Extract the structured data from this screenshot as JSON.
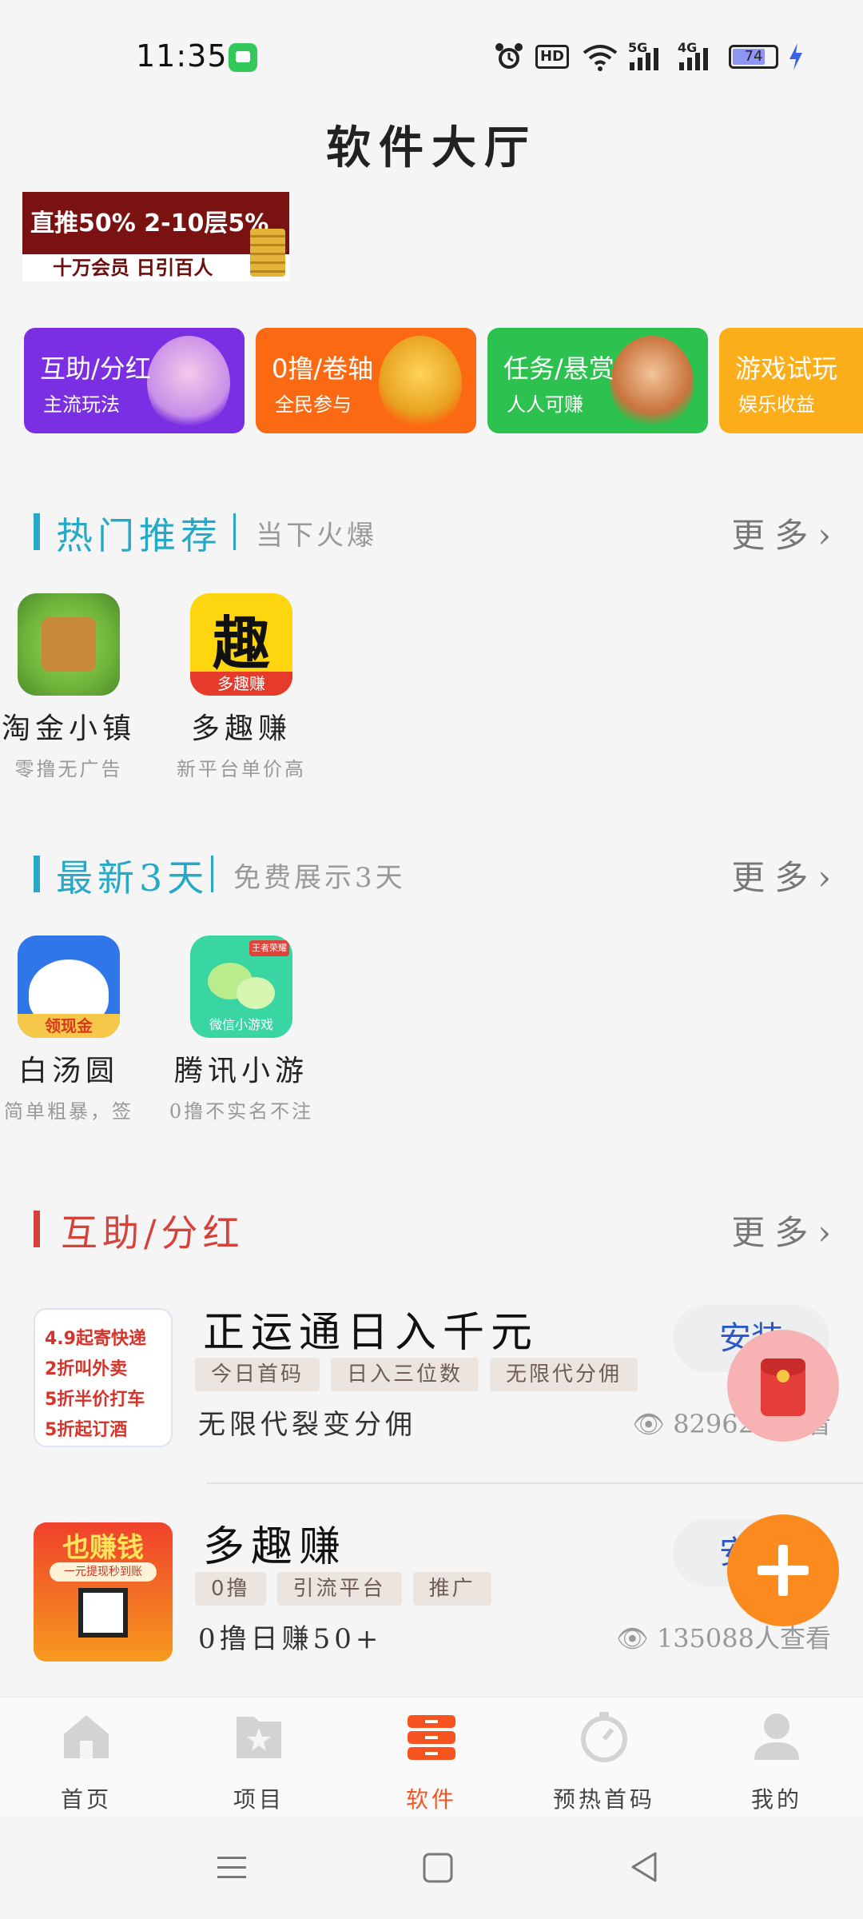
{
  "status_bar": {
    "time": "11:35",
    "hd_label": "HD",
    "net1_label": "5G",
    "net2_label": "4G",
    "battery": "74"
  },
  "page_title": "软件大厅",
  "banner": {
    "line1": "直推50% 2-10层5%",
    "line2": "十万会员 日引百人"
  },
  "categories": [
    {
      "name": "互助/分红",
      "sub": "主流玩法",
      "color": "#7b2fe3"
    },
    {
      "name": "0撸/卷轴",
      "sub": "全民参与",
      "color": "#fb6a12"
    },
    {
      "name": "任务/悬赏",
      "sub": "人人可赚",
      "color": "#2dc24f"
    },
    {
      "name": "游戏试玩",
      "sub": "娱乐收益",
      "color": "#fbae1a"
    }
  ],
  "section_hot": {
    "title": "热门推荐",
    "subtitle": "当下火爆",
    "more": "更多",
    "accent": "#26a9c7",
    "items": [
      {
        "name": "淘金小镇",
        "desc": "零撸无广告"
      },
      {
        "name": "多趣赚",
        "desc": "新平台单价高",
        "icon_text": "趣",
        "icon_badge": "多趣赚"
      }
    ]
  },
  "section_new": {
    "title": "最新3天",
    "subtitle": "免费展示3天",
    "more": "更多",
    "accent": "#26a9c7",
    "items": [
      {
        "name": "白汤圆",
        "desc": "简单粗暴，签",
        "icon_badge": "领现金"
      },
      {
        "name": "腾讯小游",
        "desc": "0撸不实名不注",
        "icon_badge": "微信小游戏",
        "icon_corner": "王者荣耀"
      }
    ]
  },
  "section_mutual": {
    "title": "互助/分红",
    "more": "更多",
    "accent": "#d6423a",
    "items": [
      {
        "title": "正运通日入千元",
        "tags": [
          "今日首码",
          "日入三位数",
          "无限代分佣"
        ],
        "desc": "无限代裂变分佣",
        "views": "82962人查看",
        "install": "安装",
        "thumb_lines": [
          "4.9起寄快递",
          "2折叫外卖",
          "5折半价打车",
          "5折起订酒"
        ]
      },
      {
        "title": "多趣赚",
        "tags": [
          "0撸",
          "引流平台",
          "推广"
        ],
        "desc": "0撸日赚50+",
        "views": "135088人查看",
        "install": "安装",
        "thumb_lines": [
          "也赚钱",
          "一元提现秒到账"
        ]
      }
    ]
  },
  "tabbar": {
    "active_color": "#f5541f",
    "items": [
      {
        "label": "首页"
      },
      {
        "label": "项目"
      },
      {
        "label": "软件"
      },
      {
        "label": "预热首码"
      },
      {
        "label": "我的"
      }
    ]
  }
}
